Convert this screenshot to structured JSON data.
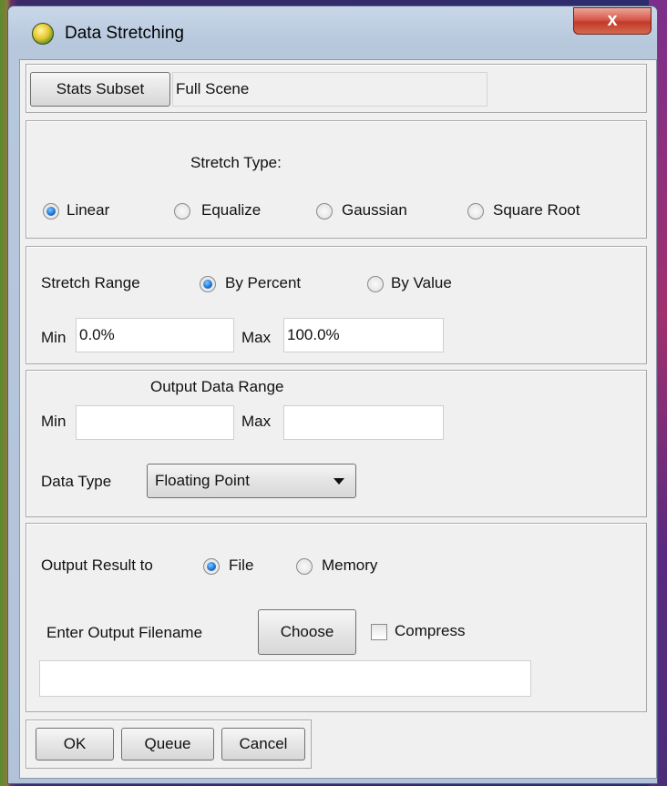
{
  "window": {
    "title": "Data Stretching",
    "close_label": "x"
  },
  "stats": {
    "button": "Stats Subset",
    "value": "Full Scene"
  },
  "stretch_type": {
    "label": "Stretch Type:",
    "options": [
      "Linear",
      "Equalize",
      "Gaussian",
      "Square Root"
    ],
    "selected": "Linear"
  },
  "stretch_range": {
    "label": "Stretch Range",
    "options": [
      "By Percent",
      "By Value"
    ],
    "selected": "By Percent",
    "min_label": "Min",
    "min_value": "0.0%",
    "max_label": "Max",
    "max_value": "100.0%"
  },
  "output_range": {
    "title": "Output Data Range",
    "min_label": "Min",
    "min_value": "",
    "max_label": "Max",
    "max_value": "",
    "data_type_label": "Data Type",
    "data_type_value": "Floating Point"
  },
  "output": {
    "label": "Output Result to",
    "options": [
      "File",
      "Memory"
    ],
    "selected": "File",
    "filename_label": "Enter Output Filename",
    "choose_button": "Choose",
    "compress_label": "Compress",
    "compress_checked": false,
    "filename_value": ""
  },
  "buttons": {
    "ok": "OK",
    "queue": "Queue",
    "cancel": "Cancel"
  }
}
